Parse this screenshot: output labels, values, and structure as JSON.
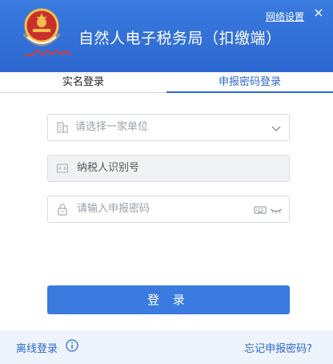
{
  "header": {
    "app_title": "自然人电子税务局（扣缴端）",
    "network_settings": "网络设置",
    "brand_color": "#2c67cf"
  },
  "tabs": [
    {
      "label": "实名登录",
      "active": false
    },
    {
      "label": "申报密码登录",
      "active": true
    }
  ],
  "form": {
    "unit_select": {
      "placeholder": "请选择一家单位",
      "icon": "building-icon"
    },
    "taxpayer_id": {
      "value": "纳税人识别号",
      "icon": "code-icon"
    },
    "password": {
      "placeholder": "请输入申报密码",
      "icon": "lock-icon"
    },
    "login_label": "登 录"
  },
  "footer": {
    "offline_login": "离线登录",
    "forgot_password": "忘记申报密码?"
  },
  "icons": {
    "emblem": "tax-emblem-icon",
    "dropdown": "chevron-down-icon",
    "keyboard": "keyboard-icon",
    "eye": "eye-closed-icon",
    "info": "info-icon",
    "close": "close-icon"
  }
}
